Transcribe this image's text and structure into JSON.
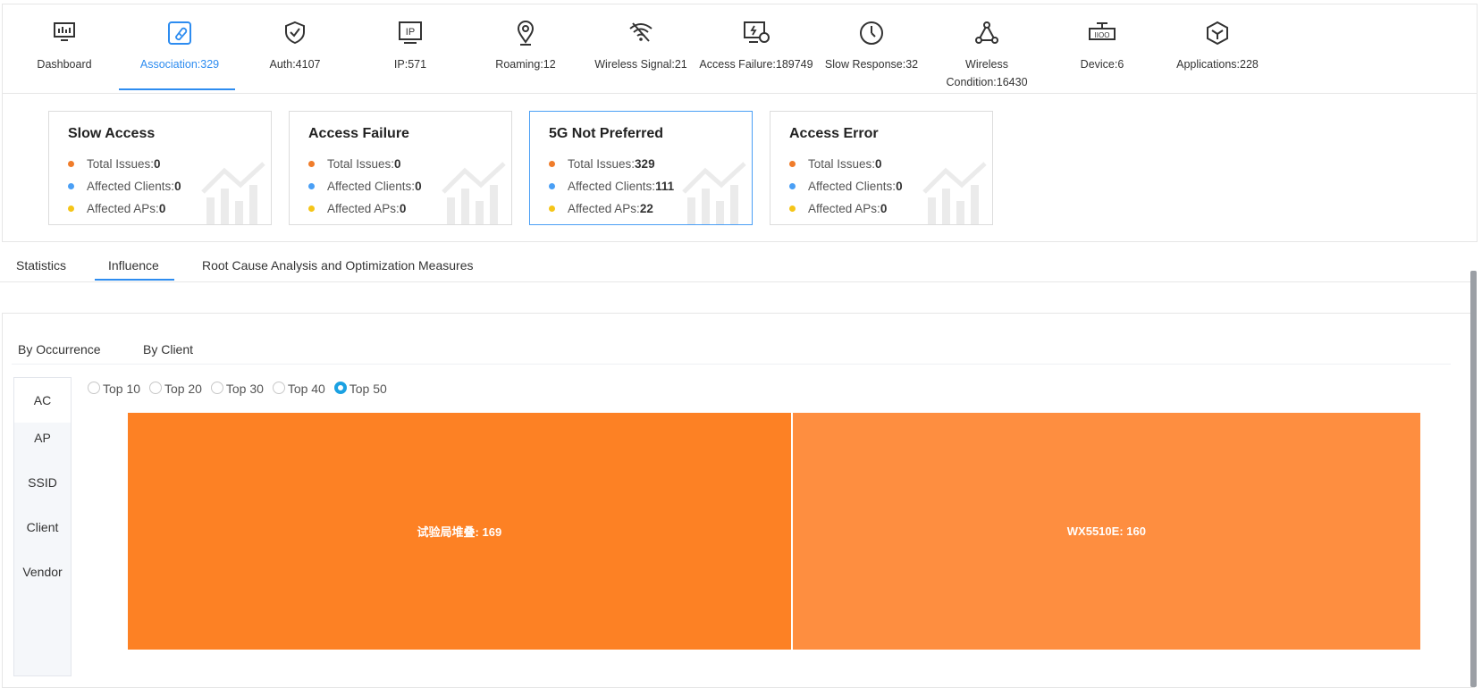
{
  "nav": {
    "items": [
      {
        "label": "Dashboard",
        "icon": "dashboard-icon"
      },
      {
        "label": "Association:329",
        "icon": "association-icon",
        "active": true
      },
      {
        "label": "Auth:4107",
        "icon": "shield-icon"
      },
      {
        "label": "IP:571",
        "icon": "ip-icon"
      },
      {
        "label": "Roaming:12",
        "icon": "location-pin-icon"
      },
      {
        "label": "Wireless Signal:21",
        "icon": "wifi-icon"
      },
      {
        "label": "Access Failure:189749",
        "icon": "monitor-alert-icon"
      },
      {
        "label": "Slow Response:32",
        "icon": "gauge-icon"
      },
      {
        "label": "Wireless Condition:16430",
        "icon": "topology-icon"
      },
      {
        "label": "Device:6",
        "icon": "device-icon"
      },
      {
        "label": "Applications:228",
        "icon": "cube-icon"
      }
    ]
  },
  "cards": [
    {
      "title": "Slow Access",
      "total_label": "Total Issues:",
      "total": "0",
      "clients_label": "Affected Clients:",
      "clients": "0",
      "aps_label": "Affected APs:",
      "aps": "0"
    },
    {
      "title": "Access Failure",
      "total_label": "Total Issues:",
      "total": "0",
      "clients_label": "Affected Clients:",
      "clients": "0",
      "aps_label": "Affected APs:",
      "aps": "0"
    },
    {
      "title": "5G Not Preferred",
      "total_label": "Total Issues:",
      "total": "329",
      "clients_label": "Affected Clients:",
      "clients": "111",
      "aps_label": "Affected APs:",
      "aps": "22",
      "selected": true
    },
    {
      "title": "Access Error",
      "total_label": "Total Issues:",
      "total": "0",
      "clients_label": "Affected Clients:",
      "clients": "0",
      "aps_label": "Affected APs:",
      "aps": "0"
    }
  ],
  "dot_colors": {
    "total": "#f07c2a",
    "clients": "#4a9ff5",
    "aps": "#f5c518"
  },
  "tabs": {
    "statistics": "Statistics",
    "influence": "Influence",
    "root_cause": "Root Cause Analysis and Optimization Measures",
    "active": "Influence"
  },
  "subtabs": {
    "by_occurrence": "By Occurrence",
    "by_client": "By Client"
  },
  "sidebar": {
    "items": [
      "AC",
      "AP",
      "SSID",
      "Client",
      "Vendor"
    ],
    "active": "AC"
  },
  "top_options": {
    "items": [
      "Top 10",
      "Top 20",
      "Top 30",
      "Top 40",
      "Top 50"
    ],
    "selected": "Top 50"
  },
  "chart_data": {
    "type": "treemap",
    "cells": [
      {
        "name": "试验局堆叠",
        "value": 169,
        "label": "试验局堆叠: 169",
        "color": "#fd8124"
      },
      {
        "name": "WX5510E",
        "value": 160,
        "label": "WX5510E: 160",
        "color": "#fe8e40"
      }
    ]
  }
}
